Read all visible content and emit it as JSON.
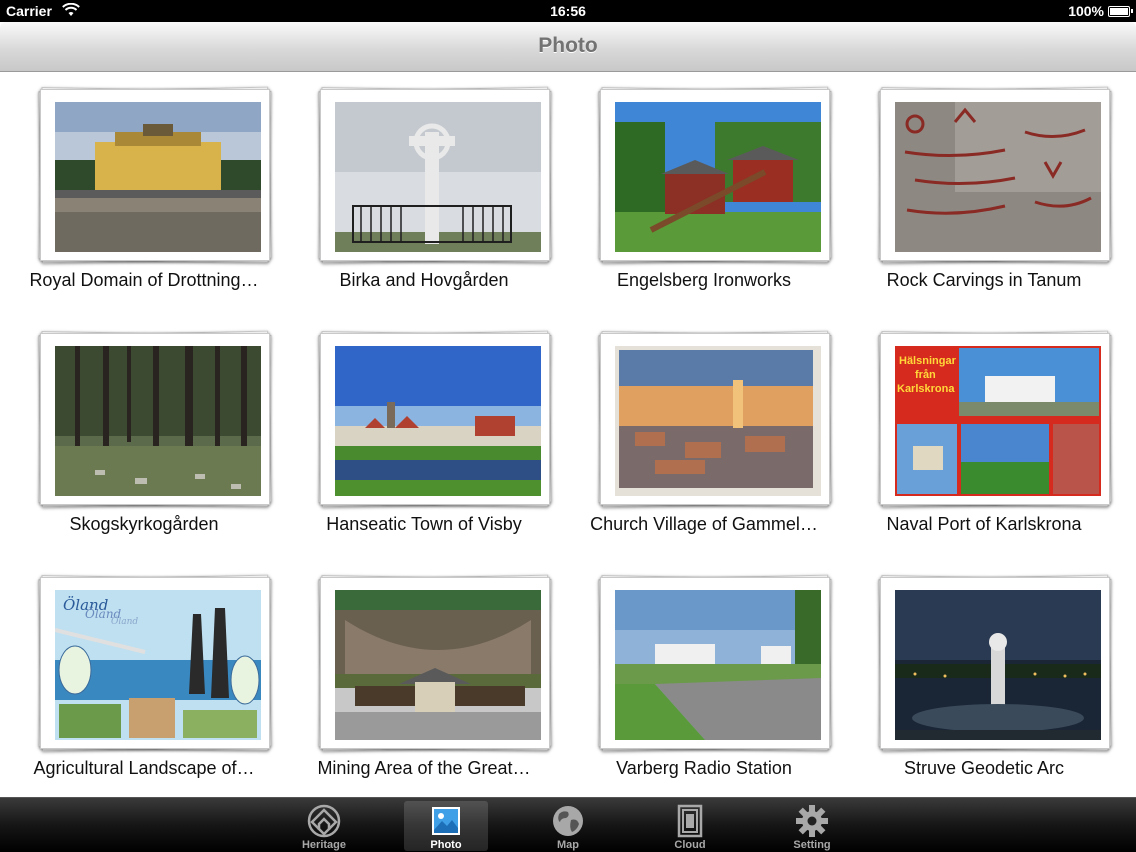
{
  "status": {
    "carrier": "Carrier",
    "time": "16:56",
    "battery": "100%"
  },
  "nav": {
    "title": "Photo"
  },
  "photos": [
    {
      "caption": "Royal Domain of Drottning…"
    },
    {
      "caption": "Birka and Hovgården"
    },
    {
      "caption": "Engelsberg Ironworks"
    },
    {
      "caption": "Rock Carvings in Tanum"
    },
    {
      "caption": "Skogskyrkogården"
    },
    {
      "caption": "Hanseatic Town of Visby"
    },
    {
      "caption": "Church Village of Gammel…"
    },
    {
      "caption": "Naval Port of Karlskrona"
    },
    {
      "caption": "Agricultural Landscape of…"
    },
    {
      "caption": "Mining Area of the Great…"
    },
    {
      "caption": "Varberg Radio Station"
    },
    {
      "caption": "Struve Geodetic Arc"
    }
  ],
  "postcard_text": {
    "karlskrona_line1": "Hälsningar",
    "karlskrona_line2": "från",
    "karlskrona_line3": "Karlskrona",
    "oland_line1": "Öland",
    "oland_line2": "Öland",
    "oland_line3": "Öland"
  },
  "tabs": [
    {
      "label": "Heritage",
      "icon": "heritage-icon",
      "active": false
    },
    {
      "label": "Photo",
      "icon": "photo-icon",
      "active": true
    },
    {
      "label": "Map",
      "icon": "globe-icon",
      "active": false
    },
    {
      "label": "Cloud",
      "icon": "cloud-icon",
      "active": false
    },
    {
      "label": "Setting",
      "icon": "gear-icon",
      "active": false
    }
  ],
  "colors": {
    "tab_active": "#ffffff",
    "tab_inactive": "#a8a8a8",
    "nav_title": "#737373"
  }
}
